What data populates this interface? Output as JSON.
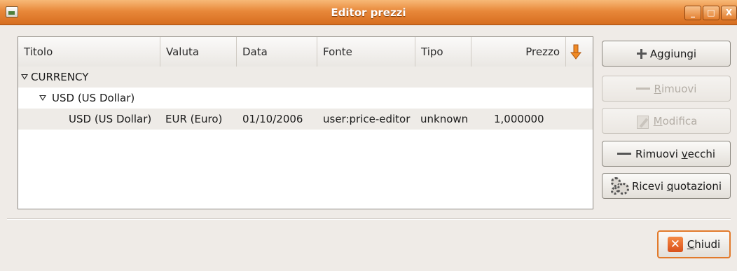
{
  "window": {
    "title": "Editor prezzi",
    "controls": {
      "minimize": "_",
      "maximize": "□",
      "close": "X"
    },
    "accent": "#e8883a"
  },
  "table": {
    "columns": [
      {
        "label": "Titolo"
      },
      {
        "label": "Valuta"
      },
      {
        "label": "Data"
      },
      {
        "label": "Fonte"
      },
      {
        "label": "Tipo"
      },
      {
        "label": "Prezzo"
      }
    ],
    "sort_icon": "sort-descending-arrow-icon",
    "tree": {
      "namespace": "CURRENCY",
      "commodity": "USD (US Dollar)",
      "rows": [
        {
          "titolo": "USD (US Dollar)",
          "valuta": "EUR (Euro)",
          "data": "01/10/2006",
          "fonte": "user:price-editor",
          "tipo": "unknown",
          "prezzo": "1,000000"
        }
      ]
    }
  },
  "buttons": {
    "add": {
      "pre": "A",
      "u": "g",
      "post": "giungi",
      "icon": "plus-icon",
      "enabled": true
    },
    "remove": {
      "pre": "",
      "u": "R",
      "post": "imuovi",
      "icon": "minus-icon",
      "enabled": false
    },
    "edit": {
      "pre": "",
      "u": "M",
      "post": "odifica",
      "icon": "edit-icon",
      "enabled": false
    },
    "remove_old": {
      "pre": "Rimuovi ",
      "u": "v",
      "post": "ecchi",
      "icon": "minus-icon",
      "enabled": true
    },
    "get_quotes": {
      "pre": "Ricevi ",
      "u": "q",
      "post": "uotazioni",
      "icon": "gears-icon",
      "enabled": true
    },
    "close": {
      "pre": "",
      "u": "C",
      "post": "hiudi",
      "icon": "close-x-icon",
      "enabled": true
    }
  }
}
